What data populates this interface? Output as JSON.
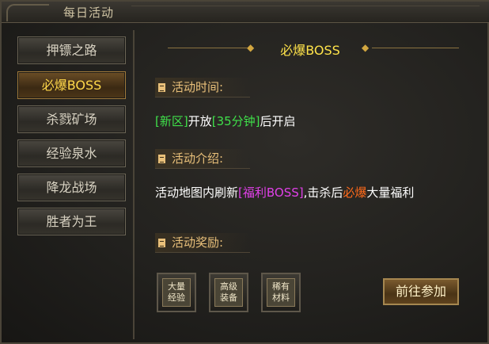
{
  "window": {
    "title": "每日活动"
  },
  "sidebar": {
    "items": [
      {
        "label": "押镖之路",
        "active": false
      },
      {
        "label": "必爆BOSS",
        "active": true
      },
      {
        "label": "杀戮矿场",
        "active": false
      },
      {
        "label": "经验泉水",
        "active": false
      },
      {
        "label": "降龙战场",
        "active": false
      },
      {
        "label": "胜者为王",
        "active": false
      }
    ]
  },
  "main": {
    "title": "必爆BOSS",
    "time_heading": "活动时间:",
    "time_text": {
      "p1": "[新区]",
      "p2": "开放",
      "p3": "[35分钟]",
      "p4": "后开启"
    },
    "intro_heading": "活动介绍:",
    "intro_text": {
      "p1": "活动地图内刷新",
      "p2": "[福利BOSS]",
      "p3": ",击杀后",
      "p4": "必爆",
      "p5": "大量福利"
    },
    "reward_heading": "活动奖励:",
    "rewards": [
      {
        "label": "大量\n经验"
      },
      {
        "label": "高级\n装备"
      },
      {
        "label": "稀有\n材料"
      }
    ],
    "go_button": "前往参加"
  },
  "colors": {
    "accent_gold": "#ffe34a",
    "heading": "#e9c07a",
    "green": "#3fe04a",
    "magenta": "#e040e8",
    "orange": "#ff6a1a"
  }
}
